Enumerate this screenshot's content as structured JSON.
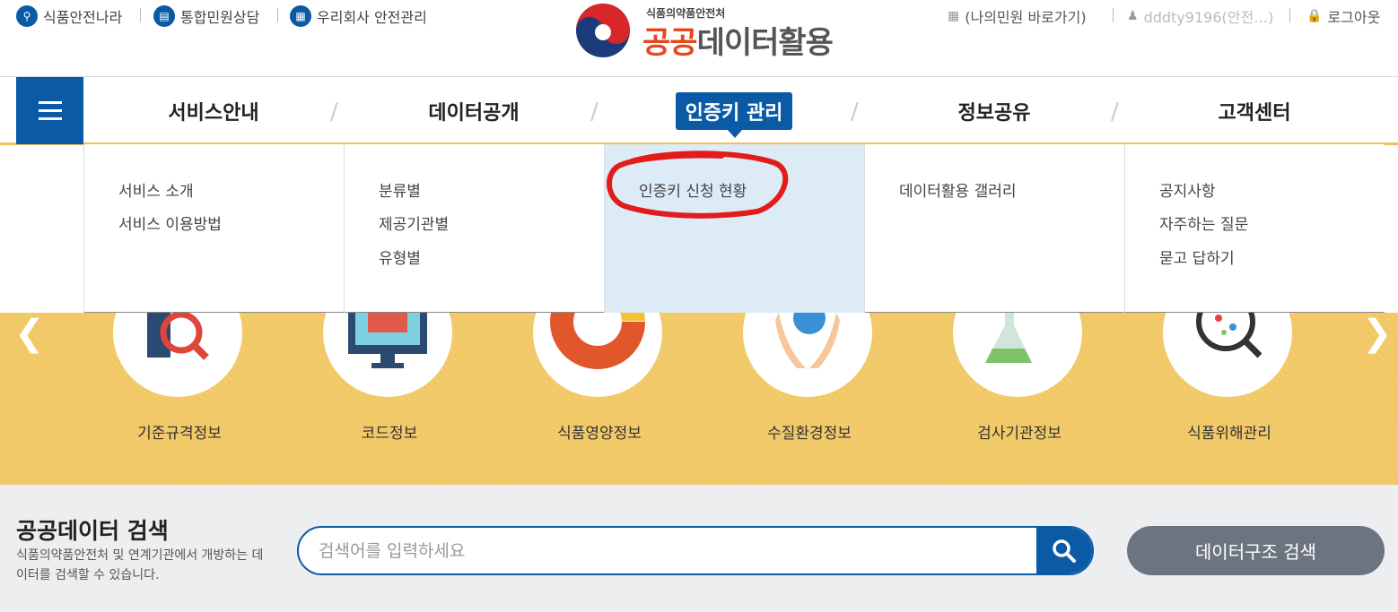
{
  "util_left": [
    {
      "label": "식품안전나라",
      "icon": "search-icon"
    },
    {
      "label": "통합민원상담",
      "icon": "document-icon"
    },
    {
      "label": "우리회사 안전관리",
      "icon": "building-icon"
    }
  ],
  "util_right": {
    "my_petition": "(나의민원 바로가기)",
    "user_id": "dddty9196(안전…)",
    "logout": "로그아웃"
  },
  "logo": {
    "sub": "식품의약품안전처",
    "main_a": "공공",
    "main_b": "데이터활용"
  },
  "nav": {
    "items": [
      "서비스안내",
      "데이터공개",
      "인증키 관리",
      "정보공유",
      "고객센터"
    ],
    "active_index": 2
  },
  "dropdown": {
    "columns": [
      [
        "서비스 소개",
        "서비스 이용방법"
      ],
      [
        "분류별",
        "제공기관별",
        "유형별"
      ],
      [
        "인증키 신청 현황"
      ],
      [
        "데이터활용 갤러리"
      ],
      [
        "공지사항",
        "자주하는 질문",
        "묻고 답하기"
      ]
    ]
  },
  "services": [
    "기준규격정보",
    "코드정보",
    "식품영양정보",
    "수질환경정보",
    "검사기관정보",
    "식품위해관리"
  ],
  "search": {
    "title": "공공데이터 검색",
    "desc": "식품의약품안전처 및 연계기관에서 개방하는 데이터를 검색할 수 있습니다.",
    "placeholder": "검색어를 입력하세요",
    "struct_button": "데이터구조 검색"
  },
  "colors": {
    "primary": "#0b5aa6",
    "band": "#f1c865",
    "annotation": "#e21b1b"
  }
}
